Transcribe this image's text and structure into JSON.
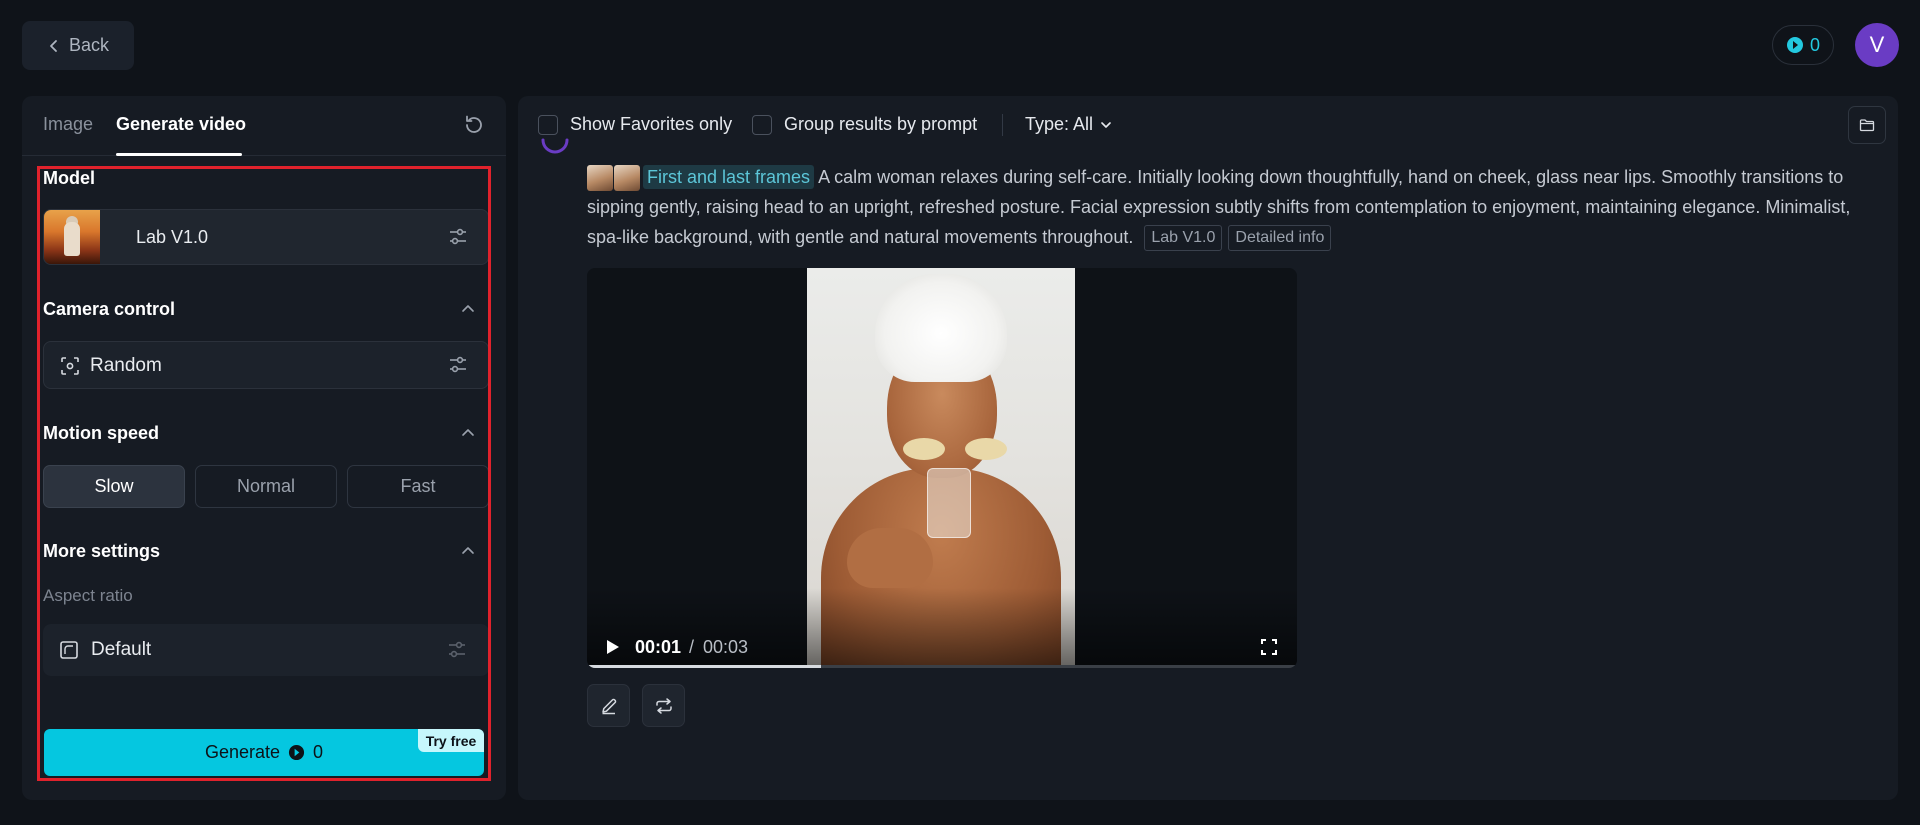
{
  "header": {
    "back_label": "Back",
    "credits": "0",
    "avatar_initial": "V"
  },
  "left_panel": {
    "tabs": [
      {
        "label": "Image",
        "active": false
      },
      {
        "label": "Generate video",
        "active": true
      }
    ],
    "model": {
      "section_label": "Model",
      "name": "Lab V1.0"
    },
    "camera_control": {
      "section_label": "Camera control",
      "value": "Random"
    },
    "motion_speed": {
      "section_label": "Motion speed",
      "options": [
        "Slow",
        "Normal",
        "Fast"
      ],
      "selected": "Slow"
    },
    "more_settings": {
      "section_label": "More settings",
      "aspect_ratio_label": "Aspect ratio",
      "aspect_ratio_value": "Default"
    },
    "generate": {
      "label": "Generate",
      "cost": "0",
      "badge": "Try free"
    }
  },
  "toolbar": {
    "favorites_label": "Show Favorites only",
    "favorites_checked": false,
    "group_label": "Group results by prompt",
    "group_checked": false,
    "type_filter": "Type: All"
  },
  "result": {
    "frames_tag": "First and last frames",
    "prompt": "A calm woman relaxes during self-care. Initially looking down thoughtfully, hand on cheek, glass near lips. Smoothly transitions to sipping gently, raising head to an upright, refreshed posture. Facial expression subtly shifts from contemplation to enjoyment, maintaining elegance. Minimalist, spa-like background, with gentle and natural movements throughout.",
    "model_chip": "Lab V1.0",
    "detail_chip": "Detailed info",
    "video": {
      "current_time": "00:01",
      "separator": "/",
      "total_time": "00:03",
      "progress_fraction": 0.33
    }
  },
  "colors": {
    "accent": "#05c7e0",
    "highlight": "#e0222c",
    "avatar": "#6a3cc4"
  }
}
